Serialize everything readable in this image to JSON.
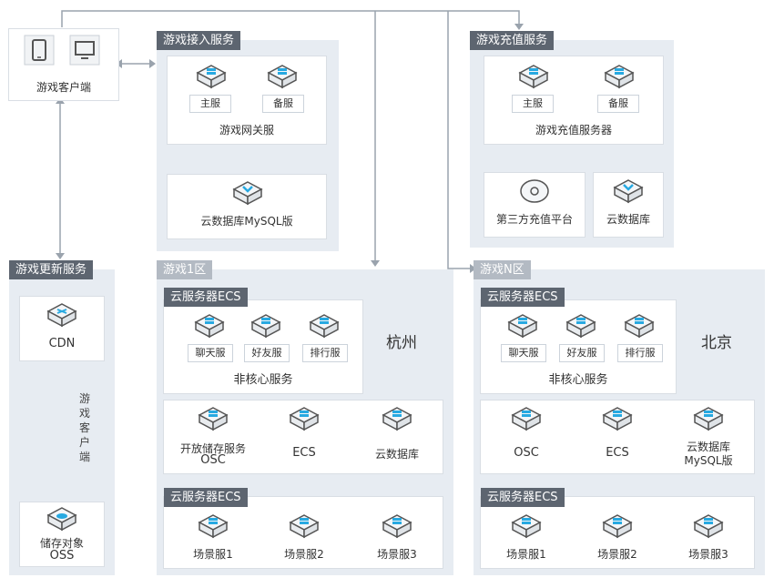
{
  "client": {
    "label": "游戏客户端"
  },
  "access": {
    "title": "游戏接入服务",
    "primary": "主服",
    "backup": "备服",
    "gateway": "游戏网关服",
    "db": "云数据库MySQL版"
  },
  "recharge": {
    "title": "游戏充值服务",
    "primary": "主服",
    "backup": "备服",
    "server": "游戏充值服务器",
    "third_party": "第三方充值平台",
    "db": "云数据库"
  },
  "update": {
    "title": "游戏更新服务",
    "cdn": "CDN",
    "vertical": [
      "游",
      "戏",
      "客",
      "户",
      "端"
    ],
    "oss": [
      "储存对象",
      "OSS"
    ]
  },
  "zone1": {
    "title": "游戏1区",
    "city": "杭州",
    "ecs_title": "云服务器ECS",
    "chat": "聊天服",
    "friend": "好友服",
    "rank": "排行服",
    "noncore": "非核心服务",
    "osc": [
      "开放储存服务",
      "OSC"
    ],
    "ecs": "ECS",
    "db": "云数据库",
    "ecs_title2": "云服务器ECS",
    "scene1": "场景服1",
    "scene2": "场景服2",
    "scene3": "场景服3"
  },
  "zoneN": {
    "title": "游戏N区",
    "city": "北京",
    "ecs_title": "云服务器ECS",
    "chat": "聊天服",
    "friend": "好友服",
    "rank": "排行服",
    "noncore": "非核心服务",
    "osc": "OSC",
    "ecs": "ECS",
    "db": [
      "云数据库",
      "MySQL版"
    ],
    "ecs_title2": "云服务器ECS",
    "scene1": "场景服1",
    "scene2": "场景服2",
    "scene3": "场景服3"
  },
  "colors": {
    "panel": "#e7ecf2",
    "title_dark": "#5d6570",
    "accent": "#27a9e1",
    "line": "#9aa3ad"
  }
}
